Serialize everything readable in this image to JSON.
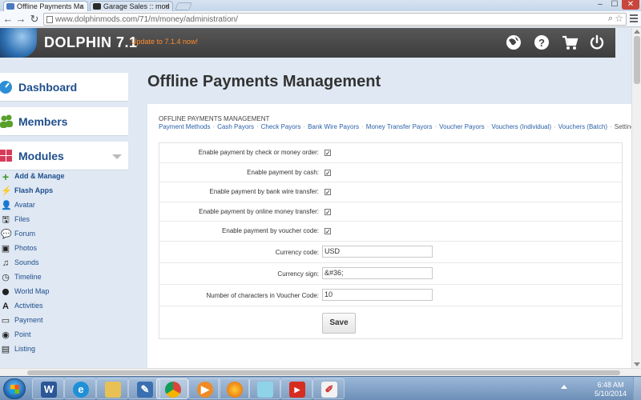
{
  "browser": {
    "tabs": [
      {
        "label": "Offline Payments Ma",
        "favicon_color": "#4a78c2",
        "active": true
      },
      {
        "label": "Garage Sales :: mod",
        "favicon_color": "#2a2a2a",
        "active": false
      }
    ],
    "url": "www.dolphinmods.com/71/m/money/administration/",
    "window_controls": [
      "–",
      "☐",
      "✕"
    ]
  },
  "header": {
    "brand": "DOLPHIN 7.1",
    "update_link": "Update to 7.1.4 now!",
    "icons": [
      "globe-icon",
      "help-icon",
      "cart-icon",
      "power-icon"
    ]
  },
  "sidebar": {
    "cards": [
      {
        "label": "Dashboard",
        "icon": "dashboard-icon",
        "color": "#2c8fd6"
      },
      {
        "label": "Members",
        "icon": "members-icon",
        "color": "#5aa02c"
      },
      {
        "label": "Modules",
        "icon": "modules-icon",
        "color": "#d63b5a"
      }
    ],
    "modules": [
      {
        "label": "Add & Manage",
        "icon": "+",
        "bold": true
      },
      {
        "label": "Flash Apps",
        "icon": "⚡",
        "bold": true
      },
      {
        "label": "Avatar",
        "icon": "👤",
        "bold": false
      },
      {
        "label": "Files",
        "icon": "🖫",
        "bold": false
      },
      {
        "label": "Forum",
        "icon": "💬",
        "bold": false
      },
      {
        "label": "Photos",
        "icon": "▣",
        "bold": false
      },
      {
        "label": "Sounds",
        "icon": "♫",
        "bold": false
      },
      {
        "label": "Timeline",
        "icon": "◷",
        "bold": false
      },
      {
        "label": "World Map",
        "icon": "⬤",
        "bold": false
      },
      {
        "label": "Activities",
        "icon": "A",
        "bold": false
      },
      {
        "label": "Payment",
        "icon": "▭",
        "bold": false
      },
      {
        "label": "Point",
        "icon": "◉",
        "bold": false
      },
      {
        "label": "Listing",
        "icon": "▤",
        "bold": false
      }
    ]
  },
  "main": {
    "title": "Offline Payments Management",
    "section_title": "OFFLINE PAYMENTS MANAGEMENT",
    "subnav": [
      {
        "label": "Payment Methods",
        "current": false
      },
      {
        "label": "Cash Payors",
        "current": false
      },
      {
        "label": "Check Payors",
        "current": false
      },
      {
        "label": "Bank Wire Payors",
        "current": false
      },
      {
        "label": "Money Transfer Payors",
        "current": false
      },
      {
        "label": "Voucher Payors",
        "current": false
      },
      {
        "label": "Vouchers (Individual)",
        "current": false
      },
      {
        "label": "Vouchers (Batch)",
        "current": false
      },
      {
        "label": "Settings",
        "current": true
      }
    ],
    "checkboxes": [
      {
        "label": "Enable payment by check or money order:",
        "checked": true
      },
      {
        "label": "Enable payment by cash:",
        "checked": true
      },
      {
        "label": "Enable payment by bank wire transfer:",
        "checked": true
      },
      {
        "label": "Enable payment by online money transfer:",
        "checked": true
      },
      {
        "label": "Enable payment by voucher code:",
        "checked": true
      }
    ],
    "fields": [
      {
        "label": "Currency code:",
        "value": "USD"
      },
      {
        "label": "Currency sign:",
        "value": "&#36;"
      },
      {
        "label": "Number of characters in Voucher Code:",
        "value": "10"
      }
    ],
    "save_label": "Save"
  },
  "taskbar": {
    "apps": [
      "word",
      "ie",
      "explorer",
      "tool",
      "chrome",
      "media",
      "firefox",
      "notes",
      "youtube",
      "paint"
    ],
    "time": "6:48 AM",
    "date": "5/10/2014"
  }
}
